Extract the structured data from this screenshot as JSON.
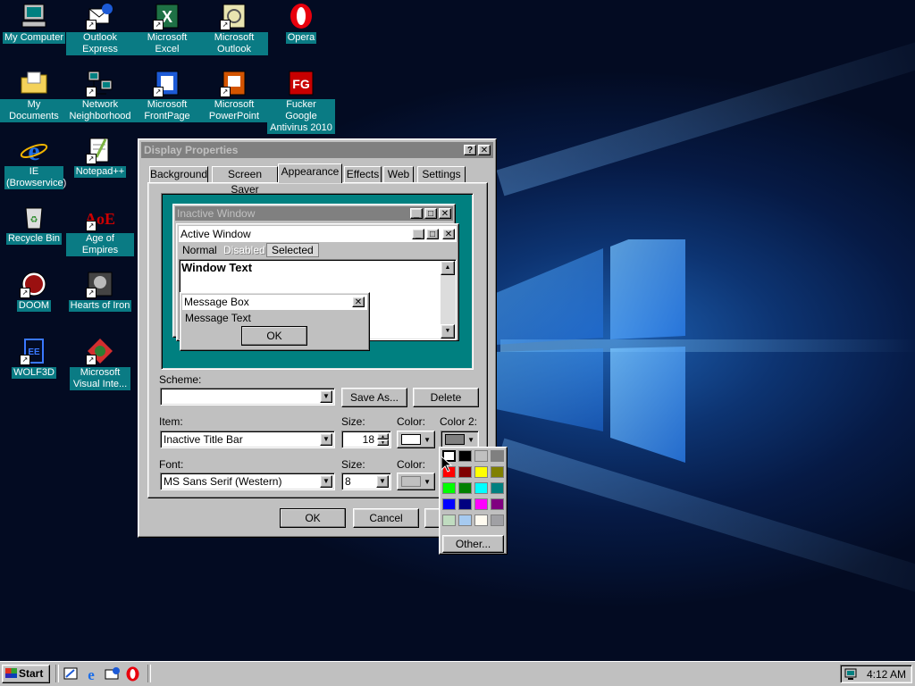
{
  "desktop": {
    "icons": [
      {
        "label": "My Computer",
        "icon": "my-computer-icon"
      },
      {
        "label": "Outlook Express",
        "icon": "outlook-express-icon"
      },
      {
        "label": "Microsoft Excel",
        "icon": "microsoft-excel-icon"
      },
      {
        "label": "Microsoft Outlook",
        "icon": "microsoft-outlook-icon"
      },
      {
        "label": "Opera",
        "icon": "opera-icon"
      },
      {
        "label": "My Documents",
        "icon": "my-documents-icon"
      },
      {
        "label": "Network Neighborhood",
        "icon": "network-neighborhood-icon"
      },
      {
        "label": "Microsoft FrontPage",
        "icon": "microsoft-frontpage-icon"
      },
      {
        "label": "Microsoft PowerPoint",
        "icon": "microsoft-powerpoint-icon"
      },
      {
        "label": "Fucker Google Antivirus 2010",
        "icon": "antivirus-icon"
      },
      {
        "label": "IE (Browservice)",
        "icon": "internet-explorer-icon"
      },
      {
        "label": "Notepad++",
        "icon": "notepad-plus-plus-icon"
      },
      {
        "label": "Recycle Bin",
        "icon": "recycle-bin-icon"
      },
      {
        "label": "Age of Empires",
        "icon": "age-of-empires-icon"
      },
      {
        "label": "DOOM",
        "icon": "doom-icon"
      },
      {
        "label": "Hearts of Iron",
        "icon": "hearts-of-iron-icon"
      },
      {
        "label": "WOLF3D",
        "icon": "wolf3d-icon"
      },
      {
        "label": "Microsoft Visual Inte...",
        "icon": "visual-interdev-icon"
      }
    ]
  },
  "dialog": {
    "title": "Display Properties",
    "title_buttons": {
      "help": "?",
      "close": "✕"
    },
    "tabs": [
      "Background",
      "Screen Saver",
      "Appearance",
      "Effects",
      "Web",
      "Settings"
    ],
    "active_tab": "Appearance",
    "preview": {
      "inactive_window_title": "Inactive Window",
      "active_window_title": "Active Window",
      "menu": {
        "normal": "Normal",
        "disabled": "Disabled",
        "selected": "Selected"
      },
      "window_text": "Window Text",
      "message_box_title": "Message Box",
      "message_text": "Message Text",
      "ok_label": "OK"
    },
    "scheme": {
      "label": "Scheme:",
      "value": "",
      "save_as": "Save As...",
      "delete": "Delete"
    },
    "item": {
      "label": "Item:",
      "value": "Inactive Title Bar"
    },
    "item_size": {
      "label": "Size:",
      "value": "18"
    },
    "item_color": {
      "label": "Color:",
      "value": "#ffffff"
    },
    "item_color2": {
      "label": "Color 2:",
      "value": "#808080"
    },
    "font": {
      "label": "Font:",
      "value": "MS Sans Serif (Western)"
    },
    "font_size": {
      "label": "Size:",
      "value": "8"
    },
    "font_color": {
      "label": "Color:",
      "value": "#c0c0c0"
    },
    "ok": "OK",
    "cancel": "Cancel"
  },
  "palette": {
    "colors": [
      "#ffffff",
      "#000000",
      "#c0c0c0",
      "#808080",
      "#ff0000",
      "#800000",
      "#ffff00",
      "#808000",
      "#00ff00",
      "#008000",
      "#00ffff",
      "#008080",
      "#0000ff",
      "#000080",
      "#ff00ff",
      "#800080",
      "#c0dcc0",
      "#a6caf0",
      "#fffbf0",
      "#a0a0a4"
    ],
    "selected_index": 0,
    "other_label": "Other..."
  },
  "taskbar": {
    "start_label": "Start",
    "quick_launch": [
      "show-desktop-icon",
      "internet-explorer-icon",
      "outlook-express-icon",
      "opera-icon"
    ],
    "clock": "4:12 AM"
  },
  "colors": {
    "desktop_label_bg": "#0a7b84",
    "inactive_title": "#808080",
    "preview_teal": "#008080",
    "face": "#c0c0c0"
  }
}
